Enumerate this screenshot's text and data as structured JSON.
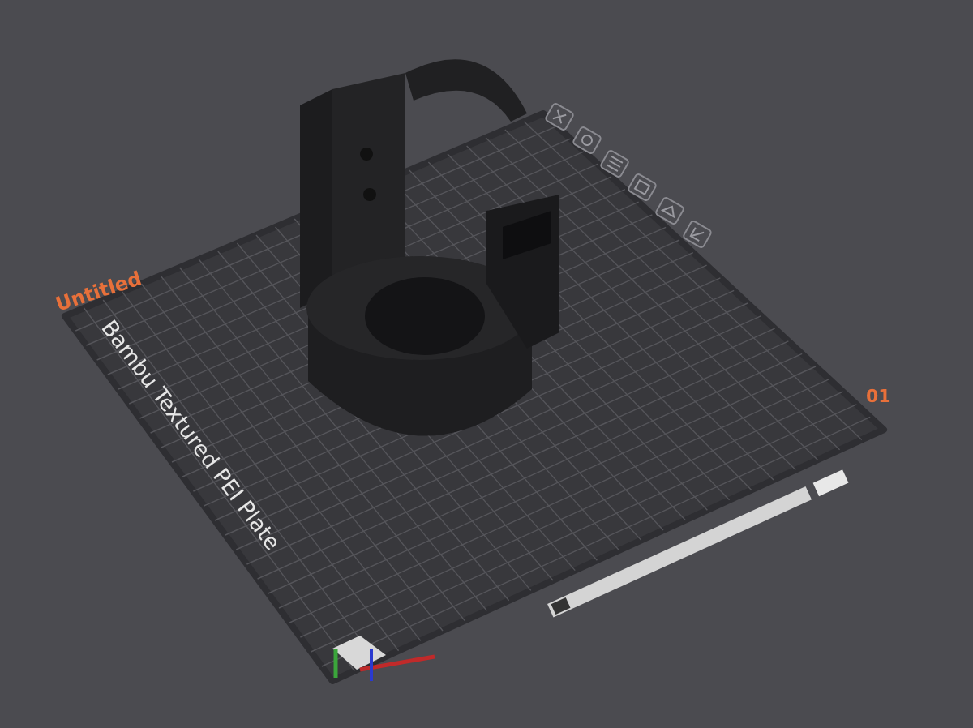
{
  "project": {
    "title": "Untitled"
  },
  "plate": {
    "name": "Bambu Textured PEI Plate",
    "number": "01"
  }
}
